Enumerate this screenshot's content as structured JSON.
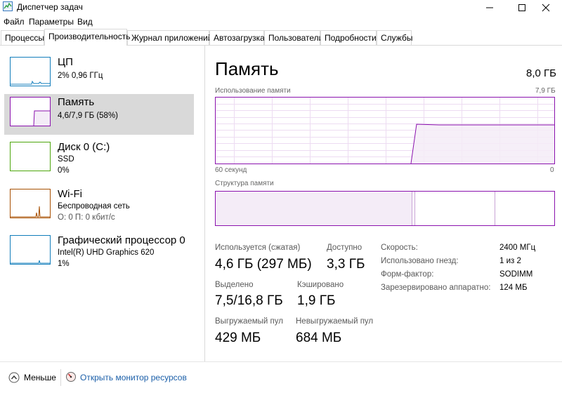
{
  "window": {
    "title": "Диспетчер задач"
  },
  "menu": [
    "Файл",
    "Параметры",
    "Вид"
  ],
  "tabs": [
    "Процессы",
    "Производительность",
    "Журнал приложений",
    "Автозагрузка",
    "Пользователи",
    "Подробности",
    "Службы"
  ],
  "active_tab": "Производительность",
  "resources": [
    {
      "name": "ЦП",
      "line1": "2%  0,96 ГГц",
      "line2": "",
      "color": "#117dbb"
    },
    {
      "name": "Память",
      "line1": "4,6/7,9 ГБ (58%)",
      "line2": "",
      "color": "#8b12ae",
      "selected": true
    },
    {
      "name": "Диск 0 (C:)",
      "line1": "SSD",
      "line2": "0%",
      "color": "#4da60c"
    },
    {
      "name": "Wi-Fi",
      "line1": "Беспроводная сеть",
      "line2": "О: 0  П: 0 кбит/с",
      "color": "#a74f01"
    },
    {
      "name": "Графический процессор 0",
      "line1": "Intel(R) UHD Graphics 620",
      "line2": "1%",
      "color": "#117dbb"
    }
  ],
  "memory": {
    "title": "Память",
    "total": "8,0 ГБ",
    "usage_label": "Использование памяти",
    "usage_max": "7,9 ГБ",
    "time_left": "60 секунд",
    "time_right": "0",
    "structure_label": "Структура памяти",
    "in_use_label": "Используется (сжатая)",
    "in_use_value": "4,6 ГБ (297 МБ)",
    "available_label": "Доступно",
    "available_value": "3,3 ГБ",
    "committed_label": "Выделено",
    "committed_value": "7,5/16,8 ГБ",
    "cached_label": "Кэшировано",
    "cached_value": "1,9 ГБ",
    "paged_label": "Выгружаемый пул",
    "paged_value": "429 МБ",
    "nonpaged_label": "Невыгружаемый пул",
    "nonpaged_value": "684 МБ",
    "details": [
      {
        "label": "Скорость:",
        "value": "2400 МГц"
      },
      {
        "label": "Использовано гнезд:",
        "value": "1 из 2"
      },
      {
        "label": "Форм-фактор:",
        "value": "SODIMM"
      },
      {
        "label": "Зарезервировано аппаратно:",
        "value": "124 МБ"
      }
    ]
  },
  "bottom": {
    "less_label": "Меньше",
    "resmon_label": "Открыть монитор ресурсов"
  }
}
